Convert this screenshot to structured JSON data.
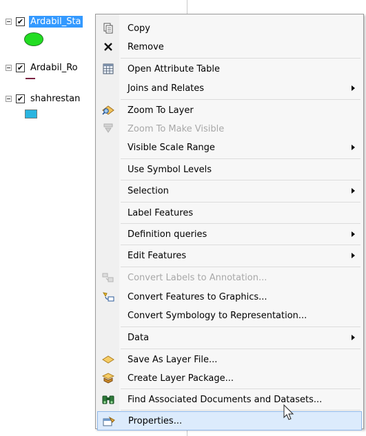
{
  "toc": {
    "layers": [
      {
        "name": "Ardabil_Sta",
        "selected": true,
        "checked": true,
        "symbol": "green-circle"
      },
      {
        "name": "Ardabil_Ro",
        "selected": false,
        "checked": true,
        "symbol": "maroon-line"
      },
      {
        "name": "shahrestan",
        "selected": false,
        "checked": true,
        "symbol": "cyan-polygon"
      }
    ],
    "check_glyph": "✔"
  },
  "menu": {
    "items": [
      {
        "label": "Copy",
        "icon": "copy-icon",
        "disabled": false,
        "submenu": false
      },
      {
        "label": "Remove",
        "icon": "remove-icon",
        "disabled": false,
        "submenu": false
      },
      {
        "label": "Open Attribute Table",
        "icon": "table-icon",
        "disabled": false,
        "submenu": false
      },
      {
        "label": "Joins and Relates",
        "icon": "",
        "disabled": false,
        "submenu": true
      },
      {
        "label": "Zoom To Layer",
        "icon": "zoom-to-layer-icon",
        "disabled": false,
        "submenu": false
      },
      {
        "label": "Zoom To Make Visible",
        "icon": "zoom-visible-icon",
        "disabled": true,
        "submenu": false
      },
      {
        "label": "Visible Scale Range",
        "icon": "",
        "disabled": false,
        "submenu": true
      },
      {
        "label": "Use Symbol Levels",
        "icon": "",
        "disabled": false,
        "submenu": false
      },
      {
        "label": "Selection",
        "icon": "",
        "disabled": false,
        "submenu": true
      },
      {
        "label": "Label Features",
        "icon": "",
        "disabled": false,
        "submenu": false
      },
      {
        "label": "Definition queries",
        "icon": "",
        "disabled": false,
        "submenu": true
      },
      {
        "label": "Edit Features",
        "icon": "",
        "disabled": false,
        "submenu": true
      },
      {
        "label": "Convert Labels to Annotation...",
        "icon": "convert-labels-icon",
        "disabled": true,
        "submenu": false
      },
      {
        "label": "Convert Features to Graphics...",
        "icon": "convert-features-icon",
        "disabled": false,
        "submenu": false
      },
      {
        "label": "Convert Symbology to Representation...",
        "icon": "",
        "disabled": false,
        "submenu": false
      },
      {
        "label": "Data",
        "icon": "",
        "disabled": false,
        "submenu": true
      },
      {
        "label": "Save As Layer File...",
        "icon": "layer-file-icon",
        "disabled": false,
        "submenu": false
      },
      {
        "label": "Create Layer Package...",
        "icon": "layer-package-icon",
        "disabled": false,
        "submenu": false
      },
      {
        "label": "Find Associated Documents and Datasets...",
        "icon": "binoculars-icon",
        "disabled": false,
        "submenu": false
      },
      {
        "label": "Properties...",
        "icon": "properties-icon",
        "disabled": false,
        "submenu": false,
        "hover": true
      }
    ]
  },
  "colors": {
    "selection": "#3399ff",
    "hover": "#dcebfc",
    "disabled_text": "#a8a8a8"
  }
}
